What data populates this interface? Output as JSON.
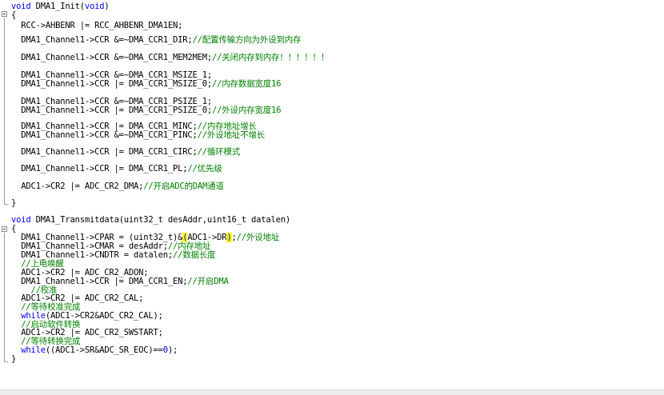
{
  "editor": {
    "lines": [
      {
        "segments": [
          {
            "t": "void",
            "c": "kw"
          },
          {
            "t": " DMA1_Init("
          },
          {
            "t": "void",
            "c": "kw"
          },
          {
            "t": ")"
          }
        ]
      },
      {
        "segments": [
          {
            "t": "{"
          }
        ]
      },
      {
        "segments": [
          {
            "t": "  RCC->AHBENR |= RCC_AHBENR_DMA1EN;"
          }
        ]
      },
      {
        "segments": [
          {
            "t": "  DMA1_Channel1->CCR &=~DMA_CCR1_DIR;"
          },
          {
            "t": "//配置传输方向为外设到内存",
            "c": "cm"
          }
        ]
      },
      {
        "segments": [
          {
            "t": "  DMA1_Channel1->CCR &=~DMA_CCR1_MEM2MEM;"
          },
          {
            "t": "//关闭内存到内存！！！！！！",
            "c": "cm"
          }
        ]
      },
      {
        "segments": [
          {
            "t": "  DMA1_Channel1->CCR &=~DMA_CCR1_MSIZE_1;"
          }
        ]
      },
      {
        "segments": [
          {
            "t": "  DMA1_Channel1->CCR |= DMA_CCR1_MSIZE_0;"
          },
          {
            "t": "//内存数据宽度16",
            "c": "cm"
          }
        ]
      },
      {
        "segments": [
          {
            "t": "  DMA1_Channel1->CCR &=~DMA_CCR1_PSIZE_1;"
          }
        ]
      },
      {
        "segments": [
          {
            "t": "  DMA1_Channel1->CCR |= DMA_CCR1_PSIZE_0;"
          },
          {
            "t": "//外设内存宽度16",
            "c": "cm"
          }
        ]
      },
      {
        "segments": [
          {
            "t": "  DMA1_Channel1->CCR |= DMA_CCR1_MINC;"
          },
          {
            "t": "//内存地址增长",
            "c": "cm"
          }
        ]
      },
      {
        "segments": [
          {
            "t": "  DMA1_Channel1->CCR &=~DMA_CCR1_PINC;"
          },
          {
            "t": "//外设地址不增长",
            "c": "cm"
          }
        ]
      },
      {
        "segments": [
          {
            "t": "  DMA1_Channel1->CCR |= DMA_CCR1_CIRC;"
          },
          {
            "t": "//循环模式",
            "c": "cm"
          }
        ]
      },
      {
        "segments": [
          {
            "t": "  DMA1_Channel1->CCR |= DMA_CCR1_PL;"
          },
          {
            "t": "//优先级",
            "c": "cm"
          }
        ]
      },
      {
        "segments": [
          {
            "t": "  ADC1->CR2 |= ADC_CR2_DMA;"
          },
          {
            "t": "//开启ADC的DAM通道",
            "c": "cm"
          }
        ]
      },
      {
        "segments": [
          {
            "t": "}"
          }
        ]
      },
      {
        "segments": [
          {
            "t": "void",
            "c": "kw"
          },
          {
            "t": " DMA1_Transmitdata(uint32_t desAddr,uint16_t datalen)"
          }
        ]
      },
      {
        "segments": [
          {
            "t": "{"
          }
        ]
      },
      {
        "segments": [
          {
            "t": "  DMA1_Channel1->CPAR = (uint32_t)&"
          },
          {
            "t": "(",
            "c": "hl"
          },
          {
            "t": "ADC1->DR"
          },
          {
            "t": ")",
            "c": "hl"
          },
          {
            "t": ";"
          },
          {
            "t": "//外设地址",
            "c": "cm"
          }
        ]
      },
      {
        "segments": [
          {
            "t": "  DMA1_Channel1->CMAR = desAddr;"
          },
          {
            "t": "//内存地址",
            "c": "cm"
          }
        ]
      },
      {
        "segments": [
          {
            "t": "  DMA1_Channel1->CNDTR = datalen;"
          },
          {
            "t": "//数据长度",
            "c": "cm"
          }
        ]
      },
      {
        "segments": [
          {
            "t": "  "
          },
          {
            "t": "//上电唤醒",
            "c": "cm"
          }
        ]
      },
      {
        "segments": [
          {
            "t": "  ADC1->CR2 |= ADC_CR2_ADON;"
          }
        ]
      },
      {
        "segments": [
          {
            "t": "  DMA1_Channel1->CCR |= DMA_CCR1_EN;"
          },
          {
            "t": "//开启DMA",
            "c": "cm"
          }
        ]
      },
      {
        "segments": [
          {
            "t": "    "
          },
          {
            "t": "//校准",
            "c": "cm"
          }
        ]
      },
      {
        "segments": [
          {
            "t": "  ADC1->CR2 |= ADC_CR2_CAL;"
          }
        ]
      },
      {
        "segments": [
          {
            "t": "  "
          },
          {
            "t": "//等待校准完成",
            "c": "cm"
          }
        ]
      },
      {
        "segments": [
          {
            "t": "  "
          },
          {
            "t": "while",
            "c": "kw"
          },
          {
            "t": "(ADC1->CR2&ADC_CR2_CAL);"
          }
        ]
      },
      {
        "segments": [
          {
            "t": "  "
          },
          {
            "t": "//启动软件转换",
            "c": "cm"
          }
        ]
      },
      {
        "segments": [
          {
            "t": "  ADC1->CR2 |= ADC_CR2_SWSTART;"
          }
        ]
      },
      {
        "segments": [
          {
            "t": "  "
          },
          {
            "t": "//等待转换完成",
            "c": "cm"
          }
        ]
      },
      {
        "segments": [
          {
            "t": "  "
          },
          {
            "t": "while",
            "c": "kw"
          },
          {
            "t": "((ADC1->SR&ADC_SR_EOC)=="
          },
          {
            "t": "0",
            "c": "kw"
          },
          {
            "t": ");"
          }
        ]
      },
      {
        "segments": [
          {
            "t": "}"
          }
        ]
      }
    ]
  }
}
